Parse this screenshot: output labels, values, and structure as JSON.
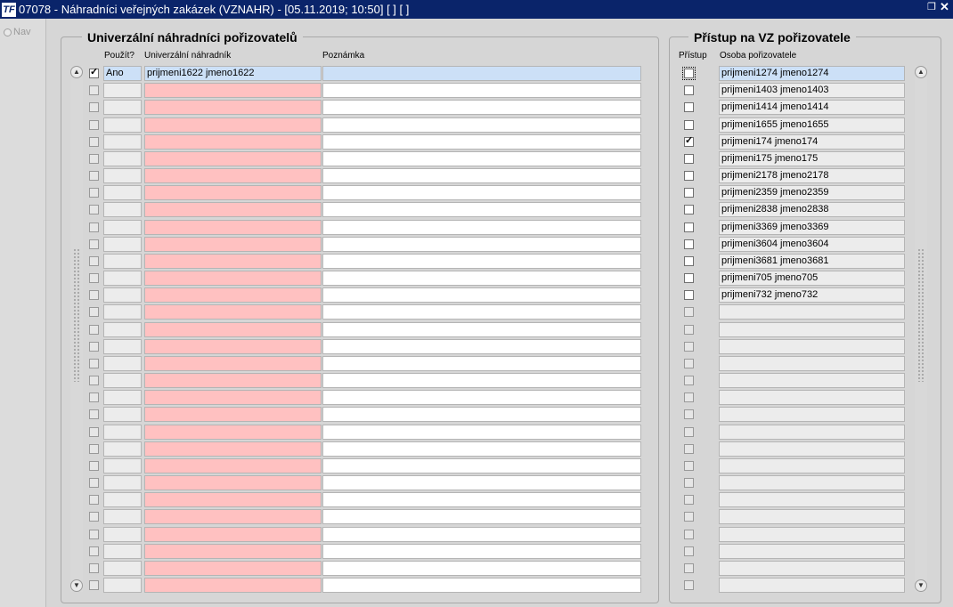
{
  "window": {
    "title": "07078 - Náhradníci veřejných zakázek (VZNAHR) - [05.11.2019; 10:50]  [ ]  [ ]",
    "app_icon_text": "TF"
  },
  "sidebar": {
    "nav_label": "Nav"
  },
  "left_panel": {
    "title": "Univerzální náhradníci pořizovatelů",
    "columns": {
      "use": "Použít?",
      "substitute": "Univerzální náhradník",
      "note": "Poznámka"
    },
    "rows": [
      {
        "checked": true,
        "use": "Ano",
        "substitute": "prijmeni1622 jmeno1622",
        "note": ""
      },
      {
        "checked": false,
        "use": "",
        "substitute": "",
        "note": ""
      },
      {
        "checked": false,
        "use": "",
        "substitute": "",
        "note": ""
      },
      {
        "checked": false,
        "use": "",
        "substitute": "",
        "note": ""
      },
      {
        "checked": false,
        "use": "",
        "substitute": "",
        "note": ""
      },
      {
        "checked": false,
        "use": "",
        "substitute": "",
        "note": ""
      },
      {
        "checked": false,
        "use": "",
        "substitute": "",
        "note": ""
      },
      {
        "checked": false,
        "use": "",
        "substitute": "",
        "note": ""
      },
      {
        "checked": false,
        "use": "",
        "substitute": "",
        "note": ""
      },
      {
        "checked": false,
        "use": "",
        "substitute": "",
        "note": ""
      },
      {
        "checked": false,
        "use": "",
        "substitute": "",
        "note": ""
      },
      {
        "checked": false,
        "use": "",
        "substitute": "",
        "note": ""
      },
      {
        "checked": false,
        "use": "",
        "substitute": "",
        "note": ""
      },
      {
        "checked": false,
        "use": "",
        "substitute": "",
        "note": ""
      },
      {
        "checked": false,
        "use": "",
        "substitute": "",
        "note": ""
      },
      {
        "checked": false,
        "use": "",
        "substitute": "",
        "note": ""
      },
      {
        "checked": false,
        "use": "",
        "substitute": "",
        "note": ""
      },
      {
        "checked": false,
        "use": "",
        "substitute": "",
        "note": ""
      },
      {
        "checked": false,
        "use": "",
        "substitute": "",
        "note": ""
      },
      {
        "checked": false,
        "use": "",
        "substitute": "",
        "note": ""
      },
      {
        "checked": false,
        "use": "",
        "substitute": "",
        "note": ""
      },
      {
        "checked": false,
        "use": "",
        "substitute": "",
        "note": ""
      },
      {
        "checked": false,
        "use": "",
        "substitute": "",
        "note": ""
      },
      {
        "checked": false,
        "use": "",
        "substitute": "",
        "note": ""
      },
      {
        "checked": false,
        "use": "",
        "substitute": "",
        "note": ""
      },
      {
        "checked": false,
        "use": "",
        "substitute": "",
        "note": ""
      },
      {
        "checked": false,
        "use": "",
        "substitute": "",
        "note": ""
      },
      {
        "checked": false,
        "use": "",
        "substitute": "",
        "note": ""
      },
      {
        "checked": false,
        "use": "",
        "substitute": "",
        "note": ""
      },
      {
        "checked": false,
        "use": "",
        "substitute": "",
        "note": ""
      },
      {
        "checked": false,
        "use": "",
        "substitute": "",
        "note": ""
      }
    ]
  },
  "right_panel": {
    "title": "Přístup na VZ pořizovatele",
    "columns": {
      "access": "Přístup",
      "person": "Osoba pořizovatele"
    },
    "rows": [
      {
        "checked": false,
        "person": "prijmeni1274 jmeno1274"
      },
      {
        "checked": false,
        "person": "prijmeni1403 jmeno1403"
      },
      {
        "checked": false,
        "person": "prijmeni1414 jmeno1414"
      },
      {
        "checked": false,
        "person": "prijmeni1655 jmeno1655"
      },
      {
        "checked": true,
        "person": "prijmeni174 jmeno174"
      },
      {
        "checked": false,
        "person": "prijmeni175 jmeno175"
      },
      {
        "checked": false,
        "person": "prijmeni2178 jmeno2178"
      },
      {
        "checked": false,
        "person": "prijmeni2359 jmeno2359"
      },
      {
        "checked": false,
        "person": "prijmeni2838 jmeno2838"
      },
      {
        "checked": false,
        "person": "prijmeni3369 jmeno3369"
      },
      {
        "checked": false,
        "person": "prijmeni3604 jmeno3604"
      },
      {
        "checked": false,
        "person": "prijmeni3681 jmeno3681"
      },
      {
        "checked": false,
        "person": "prijmeni705 jmeno705"
      },
      {
        "checked": false,
        "person": "prijmeni732 jmeno732"
      },
      {
        "checked": false,
        "person": ""
      },
      {
        "checked": false,
        "person": ""
      },
      {
        "checked": false,
        "person": ""
      },
      {
        "checked": false,
        "person": ""
      },
      {
        "checked": false,
        "person": ""
      },
      {
        "checked": false,
        "person": ""
      },
      {
        "checked": false,
        "person": ""
      },
      {
        "checked": false,
        "person": ""
      },
      {
        "checked": false,
        "person": ""
      },
      {
        "checked": false,
        "person": ""
      },
      {
        "checked": false,
        "person": ""
      },
      {
        "checked": false,
        "person": ""
      },
      {
        "checked": false,
        "person": ""
      },
      {
        "checked": false,
        "person": ""
      },
      {
        "checked": false,
        "person": ""
      },
      {
        "checked": false,
        "person": ""
      },
      {
        "checked": false,
        "person": ""
      }
    ]
  }
}
